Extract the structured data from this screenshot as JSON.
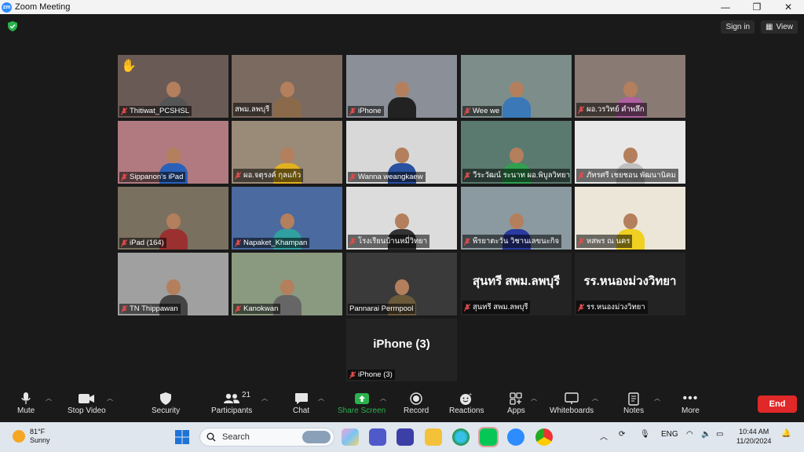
{
  "window": {
    "title": "Zoom Meeting",
    "logo": "zm",
    "controls": [
      "minimize-icon",
      "restore-icon",
      "close-icon"
    ]
  },
  "top_right": {
    "sign_in": "Sign in",
    "view": "View"
  },
  "participants_tiles": [
    {
      "name": "Thitiwat_PCSHSL",
      "muted": true,
      "hand": "✋"
    },
    {
      "name": "สพม.ลพบุรี",
      "muted": false,
      "active": true
    },
    {
      "name": "iPhone",
      "muted": true
    },
    {
      "name": "Wee we",
      "muted": true
    },
    {
      "name": "ผอ.วรวิทย์ คำพลึก",
      "muted": true
    },
    {
      "name": "Sippanon's iPad",
      "muted": true
    },
    {
      "name": "ผอ.จตุรงค์ กุลแก้ว",
      "muted": true
    },
    {
      "name": "Wanna weangkaew",
      "muted": true
    },
    {
      "name": "วีระวัฒน์ ระนาท ผอ.พิบูลวิทยา...",
      "muted": true
    },
    {
      "name": "ภัทรศรี เชยชอน พัฒนานิคม",
      "muted": true
    },
    {
      "name": "iPad (164)",
      "muted": true
    },
    {
      "name": "Napaket_Khampan",
      "muted": true
    },
    {
      "name": "โรงเรียนบ้านหมี่วิทยา",
      "muted": true
    },
    {
      "name": "พีรยาตะวัน วิชานเลขนะกิจ",
      "muted": true
    },
    {
      "name": "หสพร ณ นคร",
      "muted": true
    },
    {
      "name": "TN Thippawan",
      "muted": true
    },
    {
      "name": "Kanokwan",
      "muted": true
    },
    {
      "name": "Pannarai Permpool",
      "muted": false
    },
    {
      "name": "สุนทรี สพม.ลพบุรี",
      "muted": true,
      "display": "สุนทรี สพม.ลพบุรี"
    },
    {
      "name": "รร.หนองม่วงวิทยา",
      "muted": true,
      "display": "รร.หนองม่วงวิทยา"
    },
    {
      "name": "iPhone (3)",
      "muted": true,
      "display": "iPhone (3)"
    }
  ],
  "toolbar": {
    "mute": "Mute",
    "stop_video": "Stop Video",
    "security": "Security",
    "participants": "Participants",
    "participants_count": "21",
    "chat": "Chat",
    "share_screen": "Share Screen",
    "record": "Record",
    "reactions": "Reactions",
    "apps": "Apps",
    "whiteboards": "Whiteboards",
    "notes": "Notes",
    "more": "More",
    "end": "End"
  },
  "taskbar": {
    "weather_temp": "81°F",
    "weather_desc": "Sunny",
    "search_placeholder": "Search",
    "lang": "ENG",
    "time": "10:44 AM",
    "date": "11/20/2024"
  },
  "colors": {
    "accent_green": "#2ab24d",
    "end_red": "#e02828",
    "active_outline": "#e6e62a",
    "zoom_blue": "#2d8cff"
  }
}
